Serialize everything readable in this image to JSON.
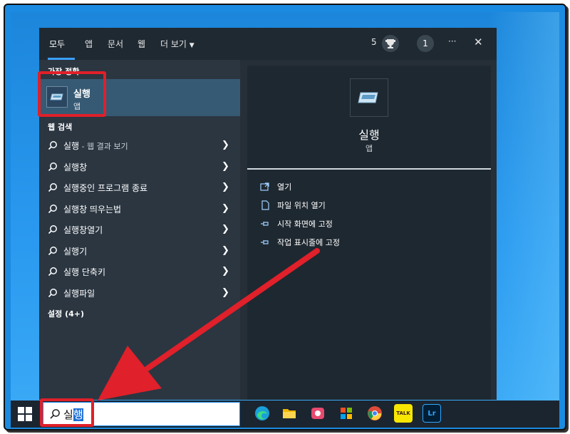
{
  "search_panel": {
    "tabs": [
      {
        "label": "모두",
        "active": true
      },
      {
        "label": "앱"
      },
      {
        "label": "문서"
      },
      {
        "label": "웹"
      },
      {
        "label": "더 보기"
      }
    ],
    "top_right": {
      "points": "5",
      "badge_count": "1",
      "more_label": "···",
      "close_label": "✕"
    },
    "best_match_label": "가장 정확",
    "best_match": {
      "title": "실행",
      "subtitle": "앱"
    },
    "web_search_label": "웹 검색",
    "web_results": [
      {
        "label": "실행",
        "hint": " - 웹 결과 보기"
      },
      {
        "label": "실행창"
      },
      {
        "label": "실행중인 프로그램 종료"
      },
      {
        "label": "실행창 띄우는법"
      },
      {
        "label": "실행창열기"
      },
      {
        "label": "실행기"
      },
      {
        "label": "실행 단축키"
      },
      {
        "label": "실행파일"
      }
    ],
    "settings_label": "설정 (4+)",
    "preview": {
      "title": "실행",
      "subtitle": "앱",
      "actions": [
        {
          "label": "열기",
          "icon": "open-icon"
        },
        {
          "label": "파일 위치 열기",
          "icon": "file-location-icon"
        },
        {
          "label": "시작 화면에 고정",
          "icon": "pin-icon"
        },
        {
          "label": "작업 표시줄에 고정",
          "icon": "pin-icon"
        }
      ]
    }
  },
  "taskbar": {
    "search_text_plain": "실",
    "search_text_selected": "행",
    "apps": [
      {
        "name": "edge-icon",
        "color": "#1aa0d8"
      },
      {
        "name": "file-explorer-icon",
        "color": "#f2b705"
      },
      {
        "name": "media-icon",
        "color": "#e84a6f"
      },
      {
        "name": "store-icon",
        "color": "#2b7bd6"
      },
      {
        "name": "chrome-icon",
        "color": "#dd4b39"
      },
      {
        "name": "kakaotalk-icon",
        "color": "#f7e600",
        "text": "TALK"
      },
      {
        "name": "lightroom-icon",
        "color": "#001e36",
        "text": "Lr"
      }
    ]
  },
  "colors": {
    "accent": "#3aa0ff",
    "highlight": "#e0202a",
    "selected_row": "#365a74"
  }
}
